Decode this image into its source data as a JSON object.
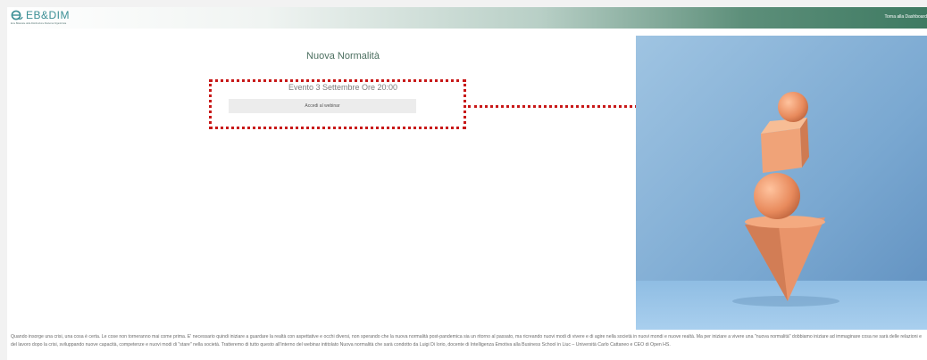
{
  "header": {
    "logo_text": "EB&DIM",
    "logo_tagline": "Ente Bilaterale della Distribuzione Moderna Organizzata",
    "back_link": "Torna alla Dashboard"
  },
  "event": {
    "title": "Nuova Normalità",
    "date": "Evento 3 Settembre Ore 20:00",
    "access_button": "Accedi al webinar"
  },
  "description": "Quando insorge una crisi, una cosa è certa. Le cose non torneranno mai come prima. E' necessario quindi iniziare a guardare la realtà con aspettative e occhi diversi, non sperando che la nuova normalità post-pandemica sia un ritorno al passato, ma ricreando nuovi modi di vivere e di agire nella società in nuovi mondi e nuove realtà. Ma per iniziare a vivere una \"nuova normalità\" dobbiamo iniziare ad immaginare cosa ne sarà delle relazioni e del lavoro dopo la crisi, sviluppando nuove capacità, competenze e nuovi modi di \"stare\" nella società. Tratteremo di tutto questo all'interno del webinar intitolato Nuova normalità che sarà condotto da Luigi Di Iorio, docente di Intelligenza Emotiva alla Business School in Liuc – Università Carlo Cattaneo e CEO di Open HS.",
  "colors": {
    "accent_green": "#4b6e5f",
    "header_gradient_end": "#3e7a62",
    "annotation_red": "#c81818",
    "logo_teal": "#3b8f95"
  }
}
